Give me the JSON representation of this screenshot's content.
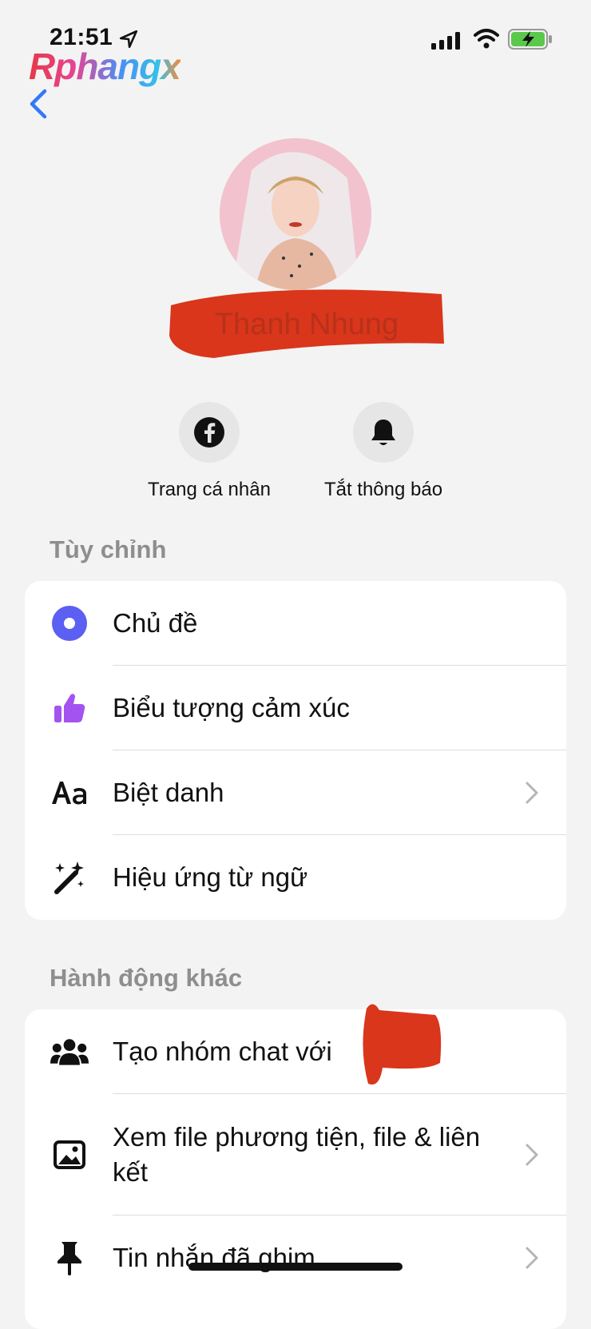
{
  "status_bar": {
    "time": "21:51"
  },
  "watermark": "Rphangx",
  "profile": {
    "name": "Thanh Nhung"
  },
  "quick_actions": [
    {
      "label": "Trang cá nhân",
      "icon": "facebook-icon"
    },
    {
      "label": "Tắt thông báo",
      "icon": "bell-icon"
    }
  ],
  "sections": [
    {
      "title": "Tùy chỉnh",
      "items": [
        {
          "label": "Chủ đề",
          "icon": "theme-icon"
        },
        {
          "label": "Biểu tượng cảm xúc",
          "icon": "thumbs-up-icon"
        },
        {
          "label": "Biệt danh",
          "icon": "text-aa-icon"
        },
        {
          "label": "Hiệu ứng từ ngữ",
          "icon": "magic-wand-icon"
        }
      ]
    },
    {
      "title": "Hành động khác",
      "items": [
        {
          "label": "Tạo nhóm chat với",
          "icon": "group-icon"
        },
        {
          "label": "Xem file phương tiện, file & liên kết",
          "icon": "image-icon"
        },
        {
          "label": "Tin nhắn đã ghim",
          "icon": "pin-icon"
        }
      ]
    }
  ],
  "colors": {
    "accent": "#3478f6",
    "theme": "#5b5ff2",
    "like": "#a354f0",
    "redaction": "#d9361b"
  }
}
